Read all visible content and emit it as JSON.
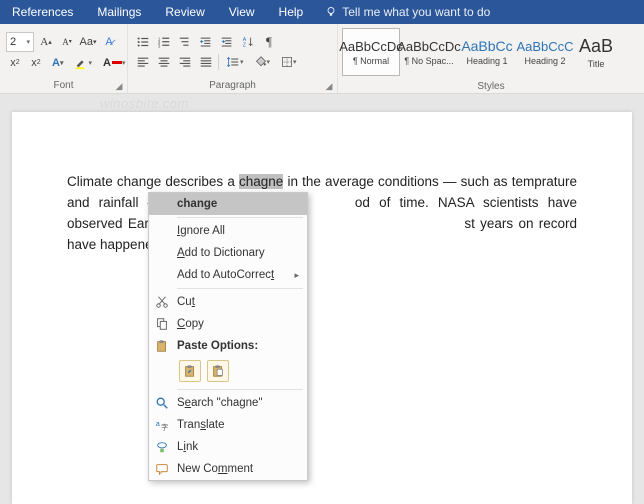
{
  "tabs": {
    "items": [
      "References",
      "Mailings",
      "Review",
      "View",
      "Help"
    ],
    "tell_me": "Tell me what you want to do"
  },
  "ribbon": {
    "font": {
      "size_value": "2",
      "label": "Font"
    },
    "paragraph": {
      "label": "Paragraph"
    },
    "styles": {
      "label": "Styles",
      "items": [
        {
          "preview": "AaBbCcDc",
          "name": "¶ Normal"
        },
        {
          "preview": "AaBbCcDc",
          "name": "¶ No Spac..."
        },
        {
          "preview": "AaBbCc",
          "name": "Heading 1"
        },
        {
          "preview": "AaBbCcC",
          "name": "Heading 2"
        },
        {
          "preview": "AaB",
          "name": "Title"
        }
      ]
    }
  },
  "watermark": "winosbite.com",
  "document": {
    "t1": "Climate change describes a ",
    "err1": "chagne",
    "t2": " in the average conditions — such as ",
    "err2": "temprature",
    "t3": " and rainfall — in",
    "t4": "od of time. NASA scientists have observed Earth's surface is warming,",
    "t5": "st years on record have happened in the past 20 years."
  },
  "context_menu": {
    "suggestion": "change",
    "ignore_all": "Ignore All",
    "add_dict": "Add to Dictionary",
    "add_ac": "Add to AutoCorrect",
    "cut": "Cut",
    "copy": "Copy",
    "paste_options": "Paste Options:",
    "search": "Search \"chagne\"",
    "translate": "Translate",
    "link": "Link",
    "new_comment": "New Comment"
  }
}
